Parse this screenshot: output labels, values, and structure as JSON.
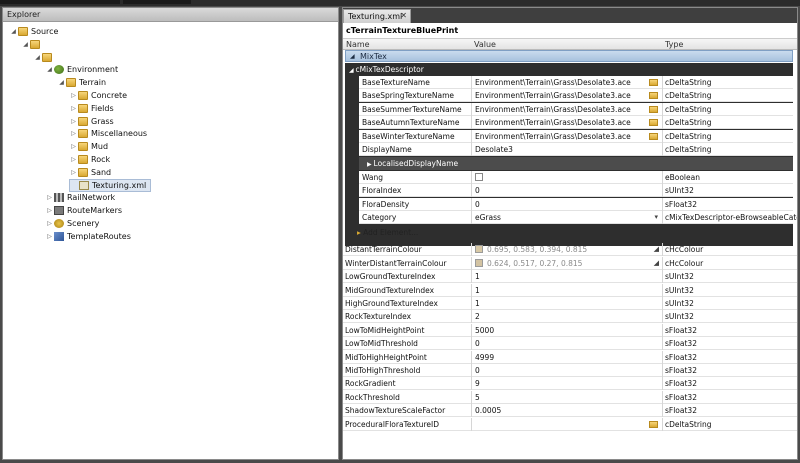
{
  "explorer": {
    "title": "Explorer",
    "tree": [
      {
        "label": "Source",
        "depth": 0,
        "expander": "◢",
        "icon": "folder-icon"
      },
      {
        "label": "",
        "depth": 1,
        "expander": "◢",
        "icon": "folder-icon"
      },
      {
        "label": "",
        "depth": 2,
        "expander": "◢",
        "icon": "folder-icon"
      },
      {
        "label": "Environment",
        "depth": 3,
        "expander": "◢",
        "icon": "environment-icon"
      },
      {
        "label": "Terrain",
        "depth": 4,
        "expander": "◢",
        "icon": "folder-icon"
      },
      {
        "label": "Concrete",
        "depth": 5,
        "expander": "▷",
        "icon": "folder-icon"
      },
      {
        "label": "Fields",
        "depth": 5,
        "expander": "▷",
        "icon": "folder-icon"
      },
      {
        "label": "Grass",
        "depth": 5,
        "expander": "▷",
        "icon": "folder-icon"
      },
      {
        "label": "Miscellaneous",
        "depth": 5,
        "expander": "▷",
        "icon": "folder-icon"
      },
      {
        "label": "Mud",
        "depth": 5,
        "expander": "▷",
        "icon": "folder-icon"
      },
      {
        "label": "Rock",
        "depth": 5,
        "expander": "▷",
        "icon": "folder-icon"
      },
      {
        "label": "Sand",
        "depth": 5,
        "expander": "▷",
        "icon": "folder-icon"
      },
      {
        "label": "Texturing.xml",
        "depth": 5,
        "expander": "",
        "icon": "xml-file-icon",
        "selected": true
      },
      {
        "label": "RailNetwork",
        "depth": 3,
        "expander": "▷",
        "icon": "rail-icon"
      },
      {
        "label": "RouteMarkers",
        "depth": 3,
        "expander": "▷",
        "icon": "marker-icon"
      },
      {
        "label": "Scenery",
        "depth": 3,
        "expander": "▷",
        "icon": "scenery-icon"
      },
      {
        "label": "TemplateRoutes",
        "depth": 3,
        "expander": "▷",
        "icon": "template-icon"
      }
    ]
  },
  "editor": {
    "tab_label": "Texturing.xml",
    "tab_close": "✕",
    "blueprint_title": "cTerrainTextureBluePrint",
    "columns": {
      "name": "Name",
      "value": "Value",
      "type": "Type"
    },
    "mixtex_label": "MixTex",
    "descriptor_label": "cMixTexDescriptor",
    "localised_label": "LocalisedDisplayName",
    "add_element_label": "Add Element...",
    "descriptor_rows": [
      {
        "name": "BaseTextureName",
        "value": "Environment\\Terrain\\Grass\\Desolate3.ace",
        "type": "cDeltaString",
        "folder": true
      },
      {
        "name": "BaseSpringTextureName",
        "value": "Environment\\Terrain\\Grass\\Desolate3.ace",
        "type": "cDeltaString",
        "folder": true
      },
      {
        "name": "BaseSummerTextureName",
        "value": "Environment\\Terrain\\Grass\\Desolate3.ace",
        "type": "cDeltaString",
        "folder": true
      },
      {
        "name": "BaseAutumnTextureName",
        "value": "Environment\\Terrain\\Grass\\Desolate3.ace",
        "type": "cDeltaString",
        "folder": true
      },
      {
        "name": "BaseWinterTextureName",
        "value": "Environment\\Terrain\\Grass\\Desolate3.ace",
        "type": "cDeltaString",
        "folder": true
      },
      {
        "name": "DisplayName",
        "value": "Desolate3",
        "type": "cDeltaString",
        "folder": false
      }
    ],
    "descriptor_rows2": [
      {
        "name": "Wang",
        "value": "",
        "type": "eBoolean",
        "kind": "checkbox",
        "checked": false
      },
      {
        "name": "FloraIndex",
        "value": "0",
        "type": "sUInt32"
      },
      {
        "name": "FloraDensity",
        "value": "0",
        "type": "sFloat32"
      },
      {
        "name": "Category",
        "value": "eGrass",
        "type": "cMixTexDescriptor-eBrowseableCateg",
        "kind": "dropdown"
      }
    ],
    "main_rows": [
      {
        "name": "DistantTerrainColour",
        "value": "0.695, 0.583, 0.394, 0.815",
        "type": "cHcColour",
        "kind": "colour",
        "swatch": "#d8c9a6"
      },
      {
        "name": "WinterDistantTerrainColour",
        "value": "0.624, 0.517, 0.27, 0.815",
        "type": "cHcColour",
        "kind": "colour",
        "swatch": "#d3c3a2"
      },
      {
        "name": "LowGroundTextureIndex",
        "value": "1",
        "type": "sUInt32"
      },
      {
        "name": "MidGroundTextureIndex",
        "value": "1",
        "type": "sUInt32"
      },
      {
        "name": "HighGroundTextureIndex",
        "value": "1",
        "type": "sUInt32"
      },
      {
        "name": "RockTextureIndex",
        "value": "2",
        "type": "sUInt32"
      },
      {
        "name": "LowToMidHeightPoint",
        "value": "5000",
        "type": "sFloat32"
      },
      {
        "name": "LowToMidThreshold",
        "value": "0",
        "type": "sFloat32"
      },
      {
        "name": "MidToHighHeightPoint",
        "value": "4999",
        "type": "sFloat32"
      },
      {
        "name": "MidToHighThreshold",
        "value": "0",
        "type": "sFloat32"
      },
      {
        "name": "RockGradient",
        "value": "9",
        "type": "sFloat32"
      },
      {
        "name": "RockThreshold",
        "value": "5",
        "type": "sFloat32"
      },
      {
        "name": "ShadowTextureScaleFactor",
        "value": "0.0005",
        "type": "sFloat32"
      },
      {
        "name": "ProceduralFloraTextureID",
        "value": "",
        "type": "cDeltaString",
        "kind": "folder"
      }
    ],
    "colors": {
      "selection": "#dde6f2",
      "group_dark": "#3a3a3a",
      "header_blue": "#b9cfe7"
    }
  }
}
